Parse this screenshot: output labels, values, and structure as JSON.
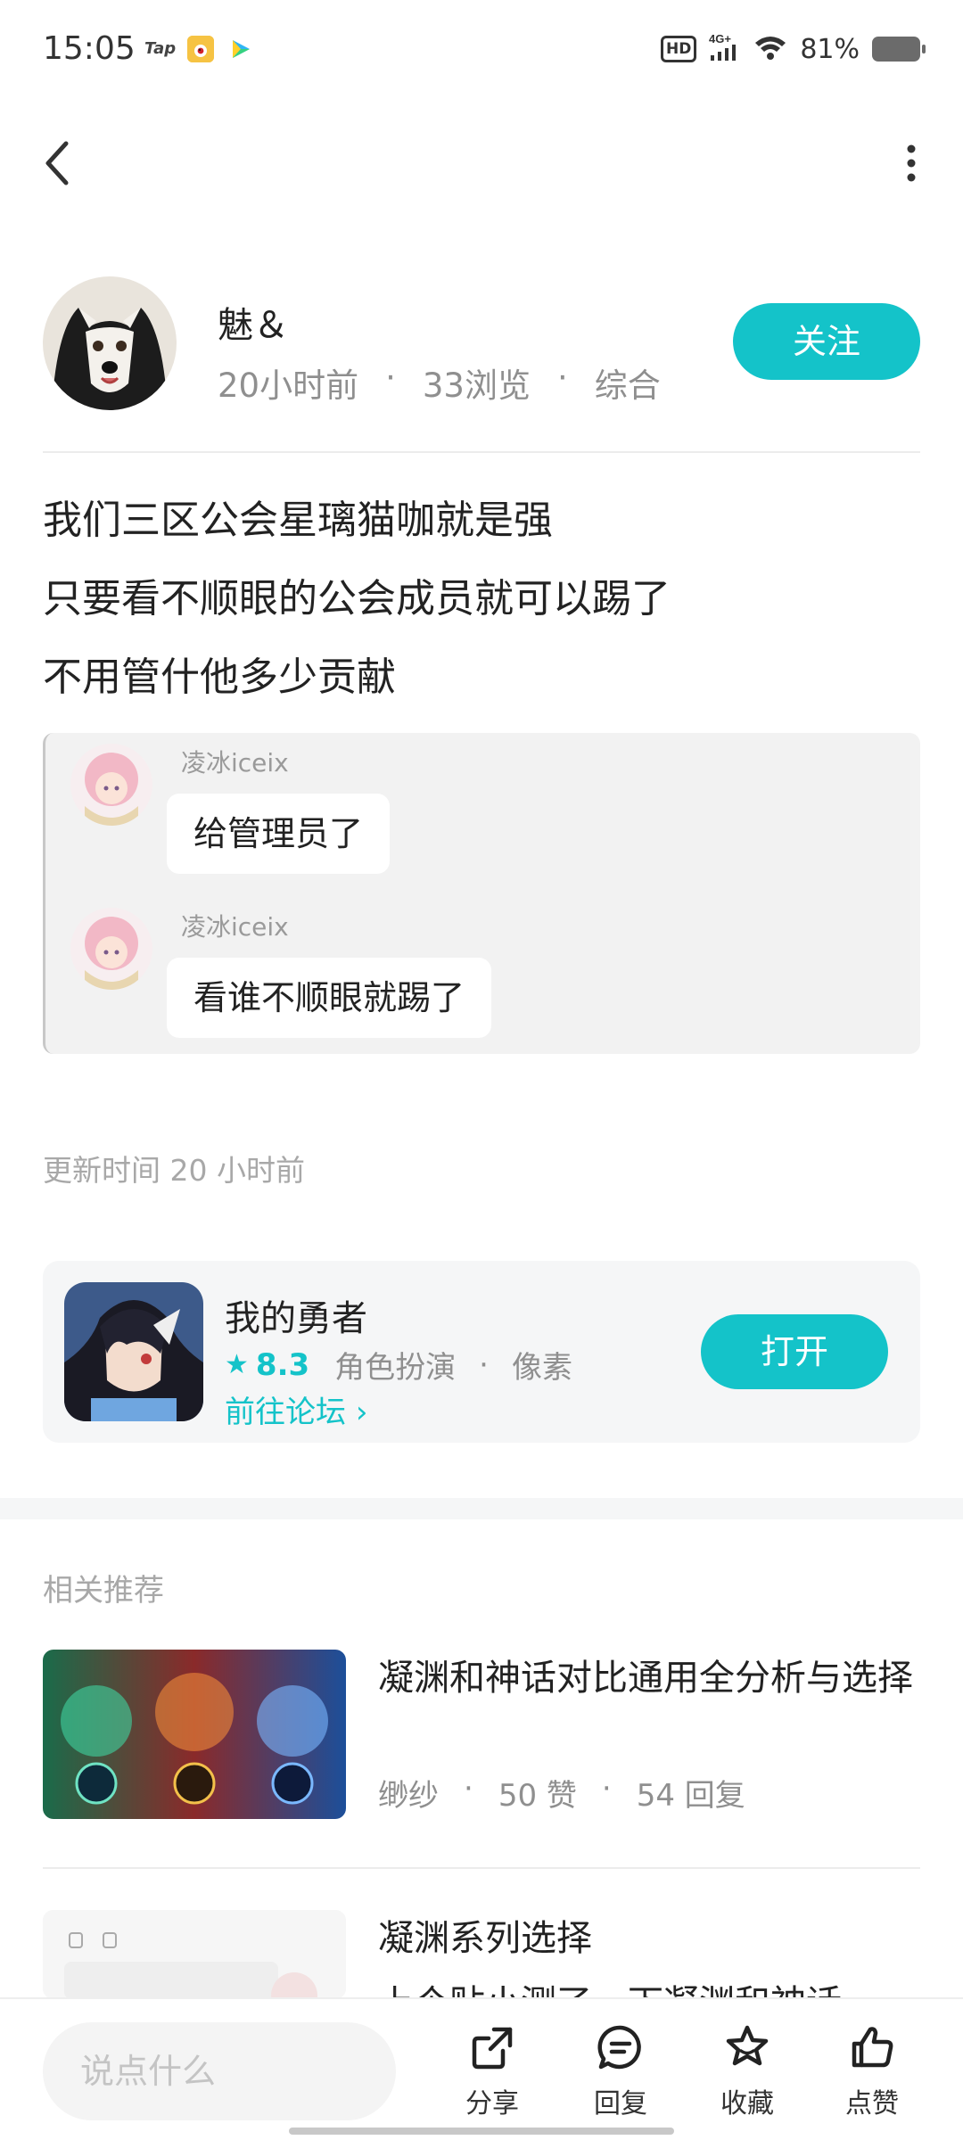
{
  "status_bar": {
    "time": "15:05",
    "apps": [
      "Tap",
      "weibo-icon",
      "video-icon"
    ],
    "hd": "HD",
    "network": "4G+",
    "battery": "81%"
  },
  "header": {
    "back_icon": "chevron-left-icon",
    "more_icon": "more-vertical-icon"
  },
  "author": {
    "name": "魅＆",
    "time": "20小时前",
    "views": "33浏览",
    "category": "综合",
    "follow_label": "关注"
  },
  "post": {
    "lines": [
      "我们三区公会星璃猫咖就是强",
      "只要看不顺眼的公会成员就可以踢了",
      "不用管什他多少贡献"
    ]
  },
  "quote": {
    "messages": [
      {
        "name": "凌冰iceix",
        "text": "给管理员了"
      },
      {
        "name": "凌冰iceix",
        "text": "看谁不顺眼就踢了"
      }
    ]
  },
  "update_time": "更新时间 20 小时前",
  "game": {
    "name": "我的勇者",
    "rating": "8.3",
    "genre": "角色扮演",
    "tag": "像素",
    "forum_link": "前往论坛 ",
    "open_label": "打开",
    "accent": "#14c3c9"
  },
  "related": {
    "title": "相关推荐",
    "items": [
      {
        "title": "凝渊和神话对比通用全分析与选择",
        "author": "缈纱",
        "likes": "50 赞",
        "replies": "54 回复"
      },
      {
        "title": "凝渊系列选择",
        "subtitle": "上个贴小测了一下凝渊和神话…"
      }
    ]
  },
  "bottom_bar": {
    "input_placeholder": "说点什么",
    "share_label": "分享",
    "reply_label": "回复",
    "favorite_label": "收藏",
    "like_label": "点赞"
  }
}
